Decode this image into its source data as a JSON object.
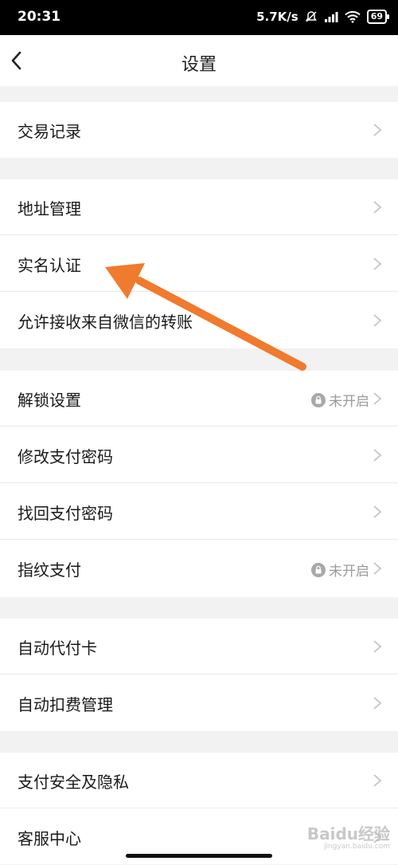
{
  "status_bar": {
    "time": "20:31",
    "network_speed": "5.7K/s",
    "battery": "69",
    "icons": [
      "mute-icon",
      "signal-icon",
      "wifi-icon",
      "battery-icon"
    ]
  },
  "header": {
    "title": "设置",
    "back_icon": "chevron-left-icon"
  },
  "sections": [
    {
      "items": [
        {
          "label": "交易记录"
        }
      ]
    },
    {
      "items": [
        {
          "label": "地址管理"
        },
        {
          "label": "实名认证"
        },
        {
          "label": "允许接收来自微信的转账"
        }
      ]
    },
    {
      "items": [
        {
          "label": "解锁设置",
          "status": "未开启"
        },
        {
          "label": "修改支付密码"
        },
        {
          "label": "找回支付密码"
        },
        {
          "label": "指纹支付",
          "status": "未开启"
        }
      ]
    },
    {
      "items": [
        {
          "label": "自动代付卡"
        },
        {
          "label": "自动扣费管理"
        }
      ]
    },
    {
      "items": [
        {
          "label": "支付安全及隐私"
        },
        {
          "label": "客服中心"
        }
      ]
    }
  ],
  "annotation": {
    "type": "arrow",
    "color": "#f07a2e"
  },
  "watermark": {
    "text": "Baidu经验",
    "sub": "jingyan.baidu.com"
  },
  "colors": {
    "background": "#f2f2f2",
    "card": "#ffffff",
    "text": "#1a1a1a",
    "muted": "#9a9a9a",
    "chevron": "#c4c4c4"
  }
}
